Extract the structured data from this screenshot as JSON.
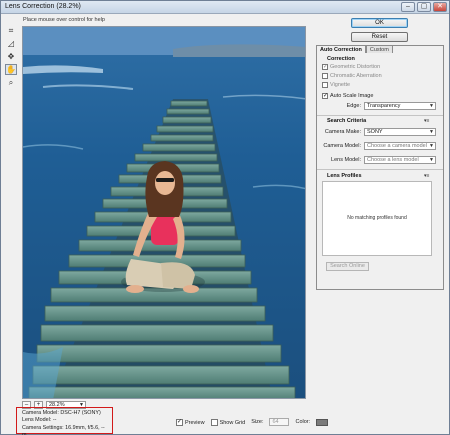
{
  "window": {
    "title": "Lens Correction (28.2%)",
    "help_text": "Place mouse over control for help",
    "controls": [
      "–",
      "▢",
      "✕"
    ]
  },
  "tools": [
    {
      "name": "remove-distortion-tool-icon",
      "glyph": "⌗"
    },
    {
      "name": "straighten-tool-icon",
      "glyph": "◿"
    },
    {
      "name": "move-grid-tool-icon",
      "glyph": "✥"
    },
    {
      "name": "hand-tool-icon",
      "glyph": "✋"
    },
    {
      "name": "zoom-tool-icon",
      "glyph": "⌕"
    }
  ],
  "buttons": {
    "ok": "OK",
    "reset": "Reset"
  },
  "tabs": [
    {
      "label": "Auto Correction",
      "active": true
    },
    {
      "label": "Custom",
      "active": false
    }
  ],
  "correction": {
    "heading": "Correction",
    "options": [
      {
        "label": "Geometric Distortion",
        "checked": true,
        "enabled": false
      },
      {
        "label": "Chromatic Aberration",
        "checked": false,
        "enabled": false
      },
      {
        "label": "Vignette",
        "checked": false,
        "enabled": false
      },
      {
        "label": "Auto Scale Image",
        "checked": true,
        "enabled": true
      }
    ],
    "edge_label": "Edge:",
    "edge_value": "Transparency"
  },
  "search_criteria": {
    "heading": "Search Criteria",
    "rows": [
      {
        "label": "Camera Make:",
        "value": "SONY",
        "placeholder": false
      },
      {
        "label": "Camera Model:",
        "value": "Choose a camera model",
        "placeholder": true
      },
      {
        "label": "Lens Model:",
        "value": "Choose a lens model",
        "placeholder": true
      }
    ]
  },
  "lens_profiles": {
    "heading": "Lens Profiles",
    "empty_text": "No matching profiles found",
    "search_online": "Search Online"
  },
  "zoom": {
    "minus": "–",
    "plus": "+",
    "value": "28.2%"
  },
  "metadata": {
    "camera_model": "Camera Model: DSC-H7 (SONY)",
    "lens_model": "Lens Model: --",
    "camera_settings": "Camera Settings: 16.9mm, f/5.6, --m"
  },
  "bottom": {
    "preview_label": "Preview",
    "preview_checked": true,
    "show_grid_label": "Show Grid",
    "show_grid_checked": false,
    "size_label": "Size:",
    "size_value": "64",
    "color_label": "Color:",
    "grid_color": "#7b7b7b"
  },
  "colors": {
    "accent": "#3c7fb1",
    "annotation": "#d21a1a"
  }
}
